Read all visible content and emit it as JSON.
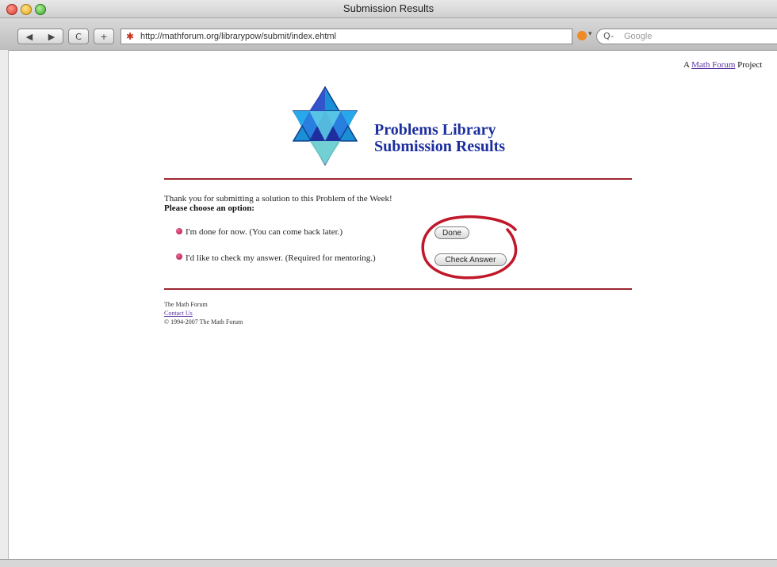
{
  "window": {
    "title": "Submission Results"
  },
  "toolbar": {
    "back_icon": "back-arrow-icon",
    "forward_icon": "forward-arrow-icon",
    "reload_label": "C",
    "add_label": "+",
    "url": "http://mathforum.org/librarypow/submit/index.ehtml",
    "search_placeholder": "Google",
    "search_prefix": "Q-"
  },
  "page": {
    "project_prefix": "A",
    "project_link": "Math Forum",
    "project_suffix": "Project",
    "heading_line1": "Problems Library",
    "heading_line2": "Submission Results",
    "thanks_text": "Thank you for submitting a solution to this Problem of the Week!",
    "choose_text": "Please choose an option:",
    "option1_text": "I'm done for now. (You can come back later.)",
    "option1_button": "Done",
    "option2_text": "I'd like to check my answer. (Required for mentoring.)",
    "option2_button": "Check Answer",
    "footer_org": "The Math Forum",
    "footer_contact": "Contact Us",
    "footer_copyright": "© 1994-2007 The Math Forum"
  },
  "colors": {
    "heading": "#1d2f9e",
    "rule": "#9e2630",
    "annotation_circle": "#c0182a"
  }
}
